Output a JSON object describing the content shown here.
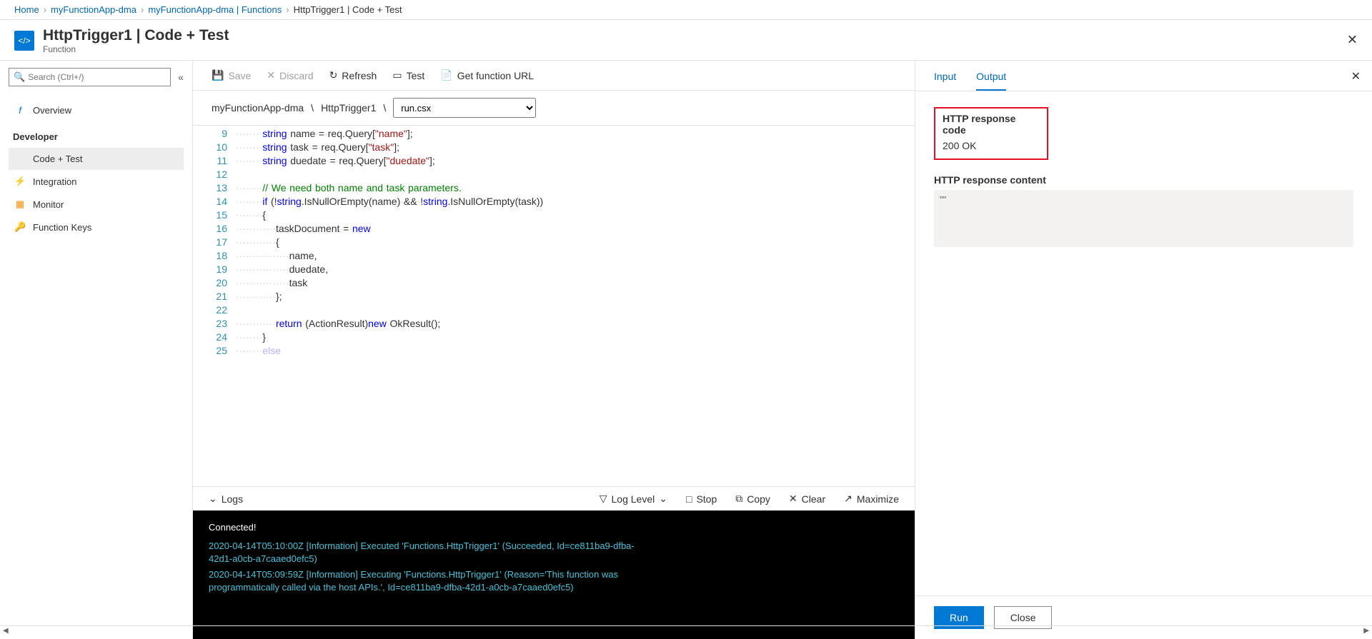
{
  "breadcrumb": [
    {
      "label": "Home",
      "link": true
    },
    {
      "label": "myFunctionApp-dma",
      "link": true
    },
    {
      "label": "myFunctionApp-dma | Functions",
      "link": true
    },
    {
      "label": "HttpTrigger1 | Code + Test",
      "link": false
    }
  ],
  "header": {
    "title": "HttpTrigger1 | Code + Test",
    "subtitle": "Function"
  },
  "search": {
    "placeholder": "Search (Ctrl+/)"
  },
  "sidebar": {
    "overview": "Overview",
    "section": "Developer",
    "items": [
      {
        "label": "Code + Test",
        "icon": "</>",
        "color": "#0078d4",
        "selected": true
      },
      {
        "label": "Integration",
        "icon": "⚡",
        "color": "#f2bc1a",
        "selected": false
      },
      {
        "label": "Monitor",
        "icon": "▦",
        "color": "#ff8c00",
        "selected": false
      },
      {
        "label": "Function Keys",
        "icon": "🔑",
        "color": "#f2bc1a",
        "selected": false
      }
    ]
  },
  "toolbar": {
    "save": "Save",
    "discard": "Discard",
    "refresh": "Refresh",
    "test": "Test",
    "get_url": "Get function URL"
  },
  "path": {
    "app": "myFunctionApp-dma",
    "func": "HttpTrigger1",
    "file": "run.csx"
  },
  "code": [
    {
      "n": 9,
      "html": "<span class='ws'>········</span><span class='kw'>string</span><span class='ws'>·</span>name<span class='ws'>·</span>=<span class='ws'>·</span>req.Query[<span class='str'>\"name\"</span>];"
    },
    {
      "n": 10,
      "html": "<span class='ws'>········</span><span class='kw'>string</span><span class='ws'>·</span>task<span class='ws'>·</span>=<span class='ws'>·</span>req.Query[<span class='str'>\"task\"</span>];"
    },
    {
      "n": 11,
      "html": "<span class='ws'>········</span><span class='kw'>string</span><span class='ws'>·</span>duedate<span class='ws'>·</span>=<span class='ws'>·</span>req.Query[<span class='str'>\"duedate\"</span>];"
    },
    {
      "n": 12,
      "html": ""
    },
    {
      "n": 13,
      "html": "<span class='ws'>········</span><span class='cm'>//</span><span class='ws'>·</span><span class='cm'>We</span><span class='ws'>·</span><span class='cm'>need</span><span class='ws'>·</span><span class='cm'>both</span><span class='ws'>·</span><span class='cm'>name</span><span class='ws'>·</span><span class='cm'>and</span><span class='ws'>·</span><span class='cm'>task</span><span class='ws'>·</span><span class='cm'>parameters.</span>"
    },
    {
      "n": 14,
      "html": "<span class='ws'>········</span><span class='kw'>if</span><span class='ws'>·</span>(!<span class='kw'>string</span>.IsNullOrEmpty(name)<span class='ws'>·</span>&amp;&amp;<span class='ws'>·</span>!<span class='kw'>string</span>.IsNullOrEmpty(task))"
    },
    {
      "n": 15,
      "html": "<span class='ws'>········</span>{"
    },
    {
      "n": 16,
      "html": "<span class='ws'>············</span>taskDocument<span class='ws'>·</span>=<span class='ws'>·</span><span class='kw'>new</span>"
    },
    {
      "n": 17,
      "html": "<span class='ws'>············</span>{"
    },
    {
      "n": 18,
      "html": "<span class='ws'>················</span>name,"
    },
    {
      "n": 19,
      "html": "<span class='ws'>················</span>duedate,"
    },
    {
      "n": 20,
      "html": "<span class='ws'>················</span>task"
    },
    {
      "n": 21,
      "html": "<span class='ws'>············</span>};"
    },
    {
      "n": 22,
      "html": ""
    },
    {
      "n": 23,
      "html": "<span class='ws'>············</span><span class='kw'>return</span><span class='ws'>·</span>(ActionResult)<span class='kw'>new</span><span class='ws'>·</span>OkResult();"
    },
    {
      "n": 24,
      "html": "<span class='ws'>········</span>}"
    },
    {
      "n": 25,
      "html": "<span class='ws'>········</span><span class='kw' style='opacity:.3'>else</span>"
    }
  ],
  "logs_bar": {
    "logs": "Logs",
    "loglevel": "Log Level",
    "stop": "Stop",
    "copy": "Copy",
    "clear": "Clear",
    "maximize": "Maximize"
  },
  "console": {
    "connected": "Connected!",
    "lines": [
      "2020-04-14T05:10:00Z   [Information]   Executed 'Functions.HttpTrigger1' (Succeeded, Id=ce811ba9-dfba-42d1-a0cb-a7caaed0efc5)",
      "2020-04-14T05:09:59Z   [Information]   Executing 'Functions.HttpTrigger1' (Reason='This function was programmatically called via the host APIs.', Id=ce811ba9-dfba-42d1-a0cb-a7caaed0efc5)"
    ]
  },
  "right": {
    "tabs": {
      "input": "Input",
      "output": "Output"
    },
    "resp_code_lbl": "HTTP response code",
    "resp_code_val": "200 OK",
    "resp_content_lbl": "HTTP response content",
    "resp_content_val": "\"\"",
    "run": "Run",
    "close": "Close"
  }
}
